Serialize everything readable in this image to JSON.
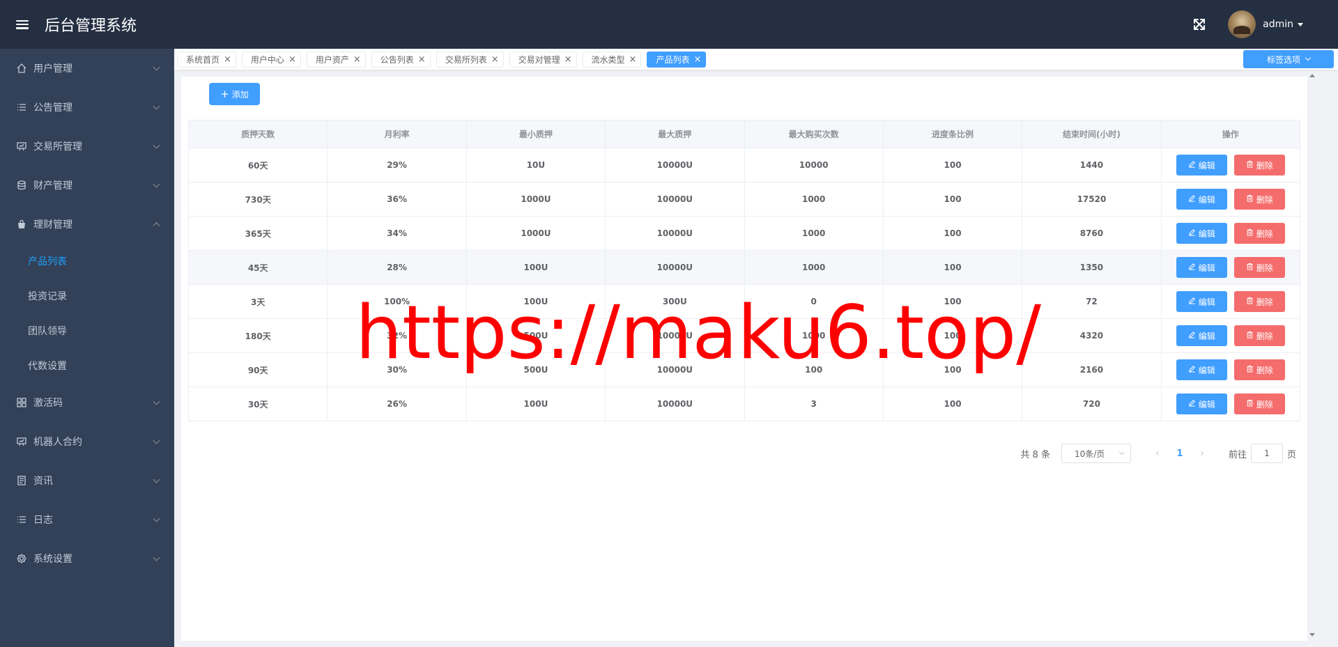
{
  "header": {
    "title": "后台管理系统",
    "username": "admin"
  },
  "sidebar": {
    "menus": [
      {
        "label": "用户管理",
        "icon": "home-icon"
      },
      {
        "label": "公告管理",
        "icon": "list-icon"
      },
      {
        "label": "交易所管理",
        "icon": "presentation-icon"
      },
      {
        "label": "财产管理",
        "icon": "database-icon"
      },
      {
        "label": "理财管理",
        "icon": "bag-icon"
      }
    ],
    "submenu": [
      {
        "label": "产品列表"
      },
      {
        "label": "投资记录"
      },
      {
        "label": "团队领导"
      },
      {
        "label": "代数设置"
      }
    ],
    "menus_after": [
      {
        "label": "激活码",
        "icon": "grid-icon"
      },
      {
        "label": "机器人合约",
        "icon": "presentation-icon"
      },
      {
        "label": "资讯",
        "icon": "document-icon"
      },
      {
        "label": "日志",
        "icon": "list-icon"
      },
      {
        "label": "系统设置",
        "icon": "gear-icon"
      }
    ]
  },
  "tags": {
    "items": [
      "系统首页",
      "用户中心",
      "用户资产",
      "公告列表",
      "交易所列表",
      "交易对管理",
      "流水类型",
      "产品列表"
    ],
    "close_glyph": "×",
    "options_label": "标签选项"
  },
  "toolbar": {
    "add_label": "添加"
  },
  "table": {
    "headers": [
      "质押天数",
      "月利率",
      "最小质押",
      "最大质押",
      "最大购买次数",
      "进度条比例",
      "结束时间(小时)",
      "操作"
    ],
    "rows": [
      [
        "60天",
        "29%",
        "10U",
        "10000U",
        "10000",
        "100",
        "1440"
      ],
      [
        "730天",
        "36%",
        "1000U",
        "10000U",
        "1000",
        "100",
        "17520"
      ],
      [
        "365天",
        "34%",
        "1000U",
        "10000U",
        "1000",
        "100",
        "8760"
      ],
      [
        "45天",
        "28%",
        "100U",
        "10000U",
        "1000",
        "100",
        "1350"
      ],
      [
        "3天",
        "100%",
        "100U",
        "300U",
        "0",
        "100",
        "72"
      ],
      [
        "180天",
        "32%",
        "500U",
        "10000U",
        "1000",
        "100",
        "4320"
      ],
      [
        "90天",
        "30%",
        "500U",
        "10000U",
        "100",
        "100",
        "2160"
      ],
      [
        "30天",
        "26%",
        "100U",
        "10000U",
        "3",
        "100",
        "720"
      ]
    ],
    "edit_label": "编辑",
    "delete_label": "删除"
  },
  "pagination": {
    "total": "共 8 条",
    "page_size": "10条/页",
    "current_page": "1",
    "goto_prefix": "前往",
    "goto_value": "1",
    "goto_suffix": "页",
    "prev_glyph": "‹",
    "next_glyph": "›"
  },
  "watermark": "https://maku6.top/",
  "colors": {
    "header_bg": "#242f42",
    "sidebar_bg": "#324157",
    "primary": "#409eff",
    "danger": "#f56c6c",
    "active_menu": "#20a0ff"
  }
}
